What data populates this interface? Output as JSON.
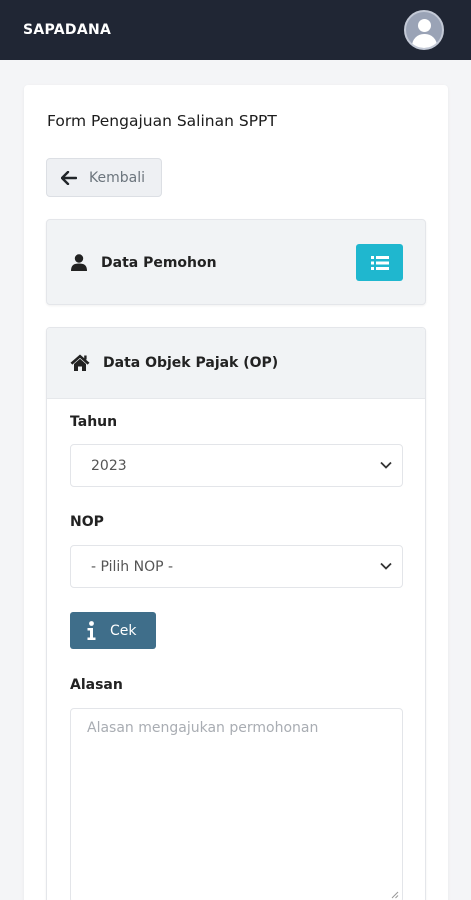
{
  "navbar": {
    "brand": "SAPADANA",
    "avatar_icon": "user-avatar-icon"
  },
  "page": {
    "title": "Form Pengajuan Salinan SPPT",
    "back_label": "Kembali"
  },
  "pemohon": {
    "label": "Data Pemohon",
    "icon": "user-icon",
    "button_icon": "list-icon",
    "button_color": "#1fb7cf"
  },
  "objek_pajak": {
    "title": "Data Objek Pajak (OP)",
    "icon": "home-icon",
    "tahun": {
      "label": "Tahun",
      "value": "2023"
    },
    "nop": {
      "label": "NOP",
      "value": "- Pilih NOP -"
    },
    "cek_label": "Cek",
    "cek_color": "#3f6e8a",
    "alasan": {
      "label": "Alasan",
      "placeholder": "Alasan mengajukan permohonan"
    }
  }
}
